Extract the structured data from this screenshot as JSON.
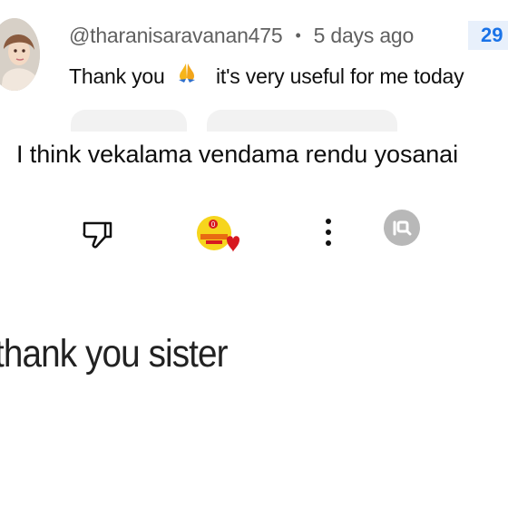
{
  "comment": {
    "author": "@tharanisaravanan475",
    "separator": "•",
    "timestamp": "5 days ago",
    "count_badge": "29",
    "text_before": "Thank you",
    "icon": "folded-hands-emoji",
    "text_after": "it's very useful for me today"
  },
  "reply": {
    "text": "I think vekalama vendama rendu yosanai"
  },
  "actions": {
    "dislike_icon": "dislike-icon",
    "heart_badge_icon": "channel-heart-badge-icon",
    "more_icon": "more-vertical-icon",
    "profile_icon": "profile-circle-icon"
  },
  "caption": {
    "text": "thank you sister"
  },
  "colors": {
    "meta_gray": "#606060",
    "accent_blue": "#1a73e8",
    "heart_red": "#d71920",
    "badge_orange": "#f6b51b"
  }
}
